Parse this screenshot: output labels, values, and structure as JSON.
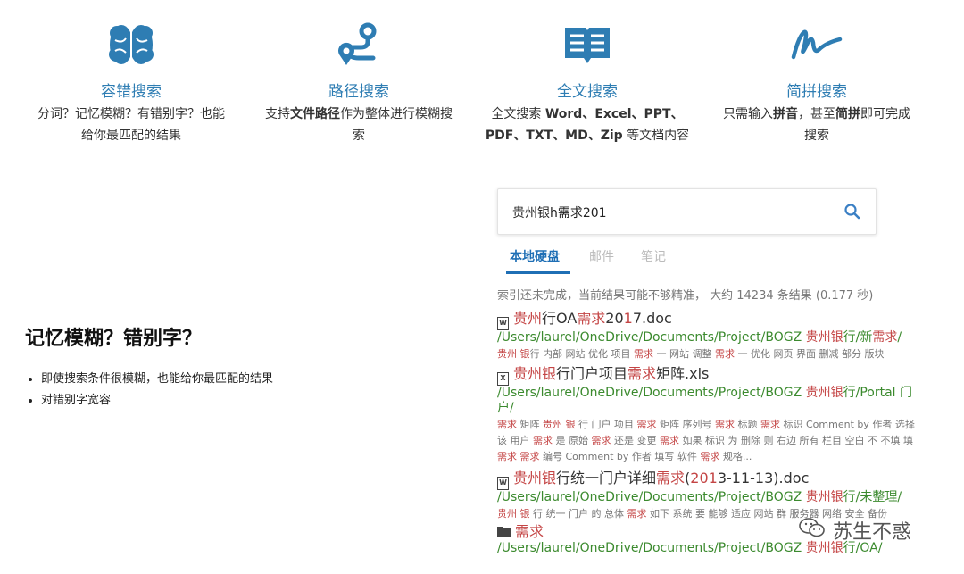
{
  "features": [
    {
      "icon": "brain-icon",
      "title": "容错搜索",
      "desc_line1": "分词？记忆模糊？有错别字？也能",
      "desc_line2": "给你最匹配的结果"
    },
    {
      "icon": "route-icon",
      "title": "路径搜索",
      "desc_pre": "支持",
      "desc_bold": "文件路径",
      "desc_post": "作为整体进行模糊搜",
      "desc_line2": "索"
    },
    {
      "icon": "book-icon",
      "title": "全文搜索",
      "desc_pre": "全文搜索 ",
      "desc_bold": "Word、Excel、PPT、",
      "desc_line2_bold": "PDF、TXT、MD、Zip",
      "desc_line2_post": " 等文档内容"
    },
    {
      "icon": "pinyin-icon",
      "title": "简拼搜索",
      "desc_pre": "只需输入",
      "desc_bold": "拼音",
      "desc_mid": "，甚至",
      "desc_bold2": "简拼",
      "desc_post": "即可完成",
      "desc_line2": "搜索"
    }
  ],
  "left": {
    "heading": "记忆模糊？错别字？",
    "bullets": [
      "即使搜索条件很模糊，也能给你最匹配的结果",
      "对错别字宽容"
    ]
  },
  "search": {
    "query": "贵州银h需求201"
  },
  "tabs": [
    "本地硬盘",
    "邮件",
    "笔记"
  ],
  "status": "索引还未完成，当前结果可能不够精准， 大约 14234 条结果 (0.177 秒)",
  "results": [
    {
      "title_parts": [
        [
          "hl",
          "贵州"
        ],
        [
          "t",
          "行OA"
        ],
        [
          "hl",
          "需求"
        ],
        [
          "t",
          "20"
        ],
        [
          "hl",
          "1"
        ],
        [
          "t",
          "7.doc"
        ]
      ],
      "path_parts": [
        [
          "t",
          "/Users/laurel/OneDrive/Documents/Project/BOGZ "
        ],
        [
          "hl",
          "贵州银"
        ],
        [
          "t",
          "行/新"
        ],
        [
          "hl",
          "需求"
        ],
        [
          "t",
          "/"
        ]
      ],
      "snippet": [
        [
          "hl",
          "贵州 银"
        ],
        [
          "t",
          "行 内部 网站 优化 项目 "
        ],
        [
          "hl",
          "需求"
        ],
        [
          "t",
          " 一 网站 调整 "
        ],
        [
          "hl",
          "需求"
        ],
        [
          "t",
          " 一 优化 网页 界面 删减 部分 版块"
        ]
      ]
    },
    {
      "title_parts": [
        [
          "hl",
          "贵州银"
        ],
        [
          "t",
          "行门户项目"
        ],
        [
          "hl",
          "需求"
        ],
        [
          "t",
          "矩阵.xls"
        ]
      ],
      "path_parts": [
        [
          "t",
          "/Users/laurel/OneDrive/Documents/Project/BOGZ "
        ],
        [
          "hl",
          "贵州银"
        ],
        [
          "t",
          "行/Portal 门户/"
        ]
      ],
      "snippet": [
        [
          "hl",
          "需求"
        ],
        [
          "t",
          " 矩阵 "
        ],
        [
          "hl",
          "贵州 银"
        ],
        [
          "t",
          " 行 门户 项目 "
        ],
        [
          "hl",
          "需求"
        ],
        [
          "t",
          " 矩阵 序列号 "
        ],
        [
          "hl",
          "需求"
        ],
        [
          "t",
          " 标题 "
        ],
        [
          "hl",
          "需求"
        ],
        [
          "t",
          " 标识 Comment by 作者 选择 该 用户 "
        ],
        [
          "hl",
          "需求"
        ],
        [
          "t",
          " 是 原始 "
        ],
        [
          "hl",
          "需求"
        ],
        [
          "t",
          " 还是 变更 "
        ],
        [
          "hl",
          "需求"
        ],
        [
          "t",
          " 如果 标识 为 删除 则 右边 所有 栏目 空白 不 不填 填 "
        ],
        [
          "hl",
          "需求 需求"
        ],
        [
          "t",
          " 编号 Comment by 作者 填写 软件 "
        ],
        [
          "hl",
          "需求"
        ],
        [
          "t",
          " 规格..."
        ]
      ]
    },
    {
      "title_parts": [
        [
          "hl",
          "贵州银"
        ],
        [
          "t",
          "行统一门户详细"
        ],
        [
          "hl",
          "需求"
        ],
        [
          "t",
          "("
        ],
        [
          "hl",
          "201"
        ],
        [
          "t",
          "3-11-13).doc"
        ]
      ],
      "path_parts": [
        [
          "t",
          "/Users/laurel/OneDrive/Documents/Project/BOGZ "
        ],
        [
          "hl",
          "贵州银"
        ],
        [
          "t",
          "行/未整理/"
        ]
      ],
      "snippet": [
        [
          "hl",
          "贵州 银"
        ],
        [
          "t",
          " 行 统一 门户 的 总体 "
        ],
        [
          "hl",
          "需求"
        ],
        [
          "t",
          " 如下 系统 要 能够 适应 网站 群 服务器 网络 安全 备份"
        ]
      ]
    },
    {
      "title_parts": [
        [
          "hl",
          "需求"
        ]
      ],
      "path_parts": [
        [
          "t",
          "/Users/laurel/OneDrive/Documents/Project/BOGZ "
        ],
        [
          "hl",
          "贵州银"
        ],
        [
          "t",
          "行/OA/"
        ]
      ],
      "snippet": []
    }
  ],
  "watermark": "苏生不惑",
  "colors": {
    "accent": "#2e7db3",
    "tab_active": "#1f6fb5",
    "path_green": "#3b8a2e",
    "highlight": "#c44545"
  }
}
